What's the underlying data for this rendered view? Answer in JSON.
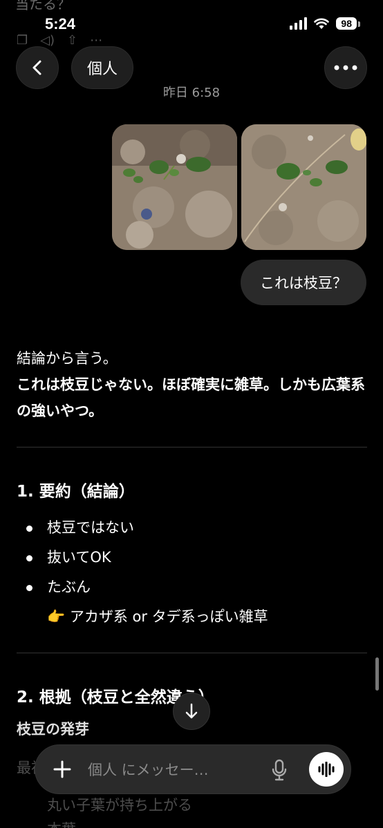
{
  "ghost_header_text": "当たる？",
  "status": {
    "time": "5:24",
    "battery": "98"
  },
  "header": {
    "title": "個人"
  },
  "conversation": {
    "timestamp": "昨日 6:58",
    "user_message": "これは枝豆？"
  },
  "answer": {
    "intro": "結論から言う。",
    "bold_statement": "これは枝豆じゃない。ほぼ確実に雑草。しかも広葉系の強いやつ。",
    "section1_title": "1. 要約（結論）",
    "bullets": [
      "枝豆ではない",
      "抜いてOK",
      "たぶん"
    ],
    "sub_emoji": "👉",
    "sub_bullet": "アカザ系 or タデ系っぽい雑草",
    "section2_title": "2. 根拠（枝豆と全然違う）",
    "section2_sub": "枝豆の発芽",
    "faded_line1": "最初に",
    "faded_bullet": "丸い子葉が持ち上がる",
    "faded_line3": "本葉"
  },
  "composer": {
    "placeholder": "個人 にメッセー…"
  },
  "icons": {
    "back": "chevron-left-icon",
    "more": "ellipsis-icon",
    "scroll": "arrow-down-icon",
    "plus": "plus-icon",
    "mic": "microphone-icon",
    "voice": "waveform-icon"
  }
}
